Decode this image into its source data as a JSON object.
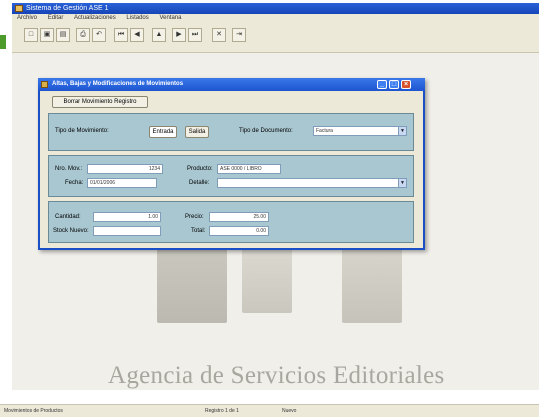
{
  "app": {
    "title": "Sistema de Gestión ASE 1",
    "menu": [
      "Archivo",
      "Editar",
      "Actualizaciones",
      "Listados",
      "Ventana"
    ]
  },
  "toolbar": {
    "buttons": [
      {
        "icon": "new-document-icon",
        "glyph": "□"
      },
      {
        "icon": "save-icon",
        "glyph": "▣"
      },
      {
        "icon": "open-icon",
        "glyph": "▤"
      },
      {
        "icon": "print-icon",
        "glyph": "⎙"
      },
      {
        "icon": "undo-icon",
        "glyph": "↶"
      },
      {
        "icon": "first-record-icon",
        "glyph": "⏮"
      },
      {
        "icon": "previous-record-icon",
        "glyph": "◀"
      },
      {
        "icon": "find-icon",
        "glyph": "▲"
      },
      {
        "icon": "next-record-icon",
        "glyph": "▶"
      },
      {
        "icon": "last-record-icon",
        "glyph": "⏭"
      },
      {
        "icon": "delete-record-icon",
        "glyph": "✕"
      },
      {
        "icon": "exit-icon",
        "glyph": "⇥"
      }
    ]
  },
  "dialog": {
    "title": "Altas, Bajas y Modificaciones de Movimientos",
    "clear_button": "Borrar Movimiento Registro",
    "type_label": "Tipo de Movimiento:",
    "type_option_1": "Entrada",
    "type_option_2": "Salida",
    "doc_type_label": "Tipo de Documento:",
    "doc_type_value": "Factura",
    "num_mov_label": "Nro. Mov.:",
    "num_mov_value": "1234",
    "date_label": "Fecha:",
    "date_value": "01/01/2006",
    "product_label": "Producto:",
    "product_value": "ASE 0000 / LIBRO",
    "detail_label": "Detalle:",
    "detail_value": "",
    "quantity_label": "Cantidad:",
    "quantity_value": "1.00",
    "price_label": "Precio:",
    "price_value": "25.00",
    "new_stock_label": "Stock Nuevo:",
    "new_stock_value": "",
    "total_label": "Total:",
    "total_value": "0.00"
  },
  "workspace": {
    "brand_text": "Agencia de Servicios Editoriales"
  },
  "status": {
    "left": "Movimientos de Productos",
    "middle": "Registro 1 de 1",
    "right": "Nuevo"
  }
}
